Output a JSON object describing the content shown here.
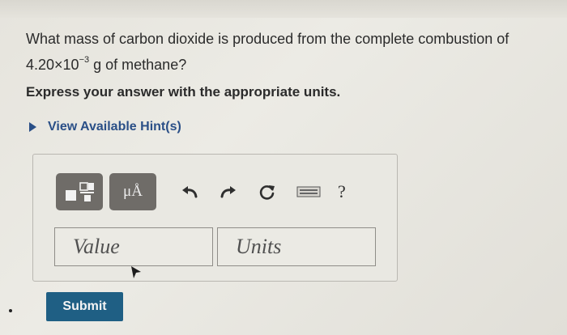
{
  "question": {
    "line1": "What mass of carbon dioxide is produced from the complete combustion of",
    "coef": "4.20×10",
    "exp": "−3",
    "rest": " g of methane?"
  },
  "instruction": "Express your answer with the appropriate units.",
  "hint_link": "View Available Hint(s)",
  "toolbar": {
    "units_button": "μÅ",
    "help": "?"
  },
  "inputs": {
    "value_placeholder": "Value",
    "units_placeholder": "Units"
  },
  "submit_label": "Submit",
  "colors": {
    "submit": "#1f5f84",
    "hint": "#2a4f87",
    "toolbar_button": "#6f6c68"
  }
}
